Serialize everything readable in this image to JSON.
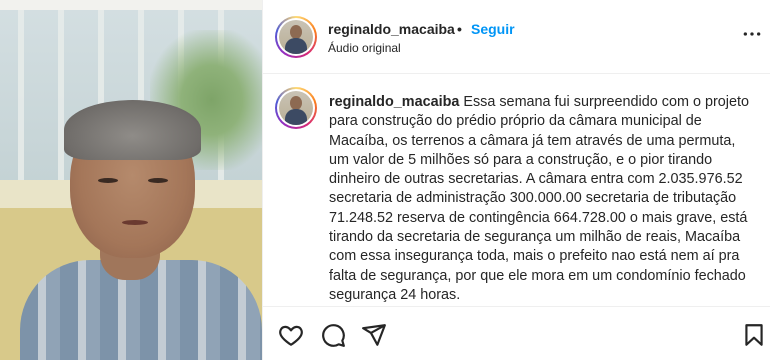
{
  "post": {
    "username": "reginaldo_macaiba",
    "separator": "•",
    "follow_label": "Seguir",
    "audio_label": "Áudio original",
    "caption": "Essa semana fui surpreendido com o projeto para construção do prédio próprio da câmara municipal de Macaíba, os terrenos a câmara já tem através de uma permuta, um valor de 5 milhões só para a construção, e o pior tirando dinheiro de outras secretarias. A câmara entra com 2.035.976.52 secretaria de administração 300.000.00 secretaria de tributação 71.248.52 reserva de contingência 664.728.00 o mais grave, está tirando da secretaria de segurança um milhão de reais, Macaíba com essa insegurança toda, mais o prefeito nao está nem aí pra falta de segurança, por que ele mora em um condomínio fechado segurança 24 horas."
  },
  "icons": {
    "more": "more-options-icon",
    "like": "heart-icon",
    "comment": "comment-icon",
    "share": "share-icon",
    "save": "bookmark-icon"
  },
  "colors": {
    "follow": "#0095f6",
    "text": "#262626",
    "border": "#efefef"
  }
}
